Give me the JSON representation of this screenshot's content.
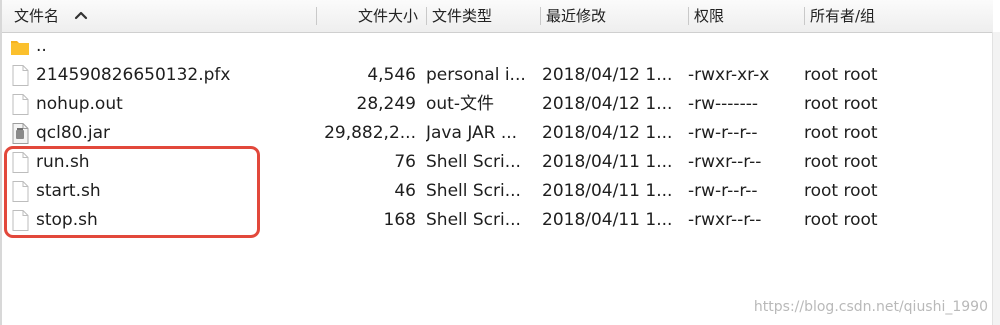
{
  "header": {
    "columns": [
      "文件名",
      "文件大小",
      "文件类型",
      "最近修改",
      "权限",
      "所有者/组"
    ],
    "sort_icon": "chevron-up-icon"
  },
  "files": [
    {
      "name": "..",
      "size": "",
      "type": "",
      "modified": "",
      "permissions": "",
      "owner": "",
      "icon": "folder-icon"
    },
    {
      "name": "214590826650132.pfx",
      "size": "4,546",
      "type": "personal i...",
      "modified": "2018/04/12 1...",
      "permissions": "-rwxr-xr-x",
      "owner": "root root",
      "icon": "file-icon"
    },
    {
      "name": "nohup.out",
      "size": "28,249",
      "type": "out-文件",
      "modified": "2018/04/12 1...",
      "permissions": "-rw-------",
      "owner": "root root",
      "icon": "file-icon"
    },
    {
      "name": "qcl80.jar",
      "size": "29,882,2...",
      "type": "Java JAR ...",
      "modified": "2018/04/12 1...",
      "permissions": "-rw-r--r--",
      "owner": "root root",
      "icon": "jar-file-icon"
    },
    {
      "name": "run.sh",
      "size": "76",
      "type": "Shell Scri...",
      "modified": "2018/04/11 1...",
      "permissions": "-rwxr--r--",
      "owner": "root root",
      "icon": "file-icon"
    },
    {
      "name": "start.sh",
      "size": "46",
      "type": "Shell Scri...",
      "modified": "2018/04/11 1...",
      "permissions": "-rw-r--r--",
      "owner": "root root",
      "icon": "file-icon"
    },
    {
      "name": "stop.sh",
      "size": "168",
      "type": "Shell Scri...",
      "modified": "2018/04/11 1...",
      "permissions": "-rwxr--r--",
      "owner": "root root",
      "icon": "file-icon"
    }
  ],
  "highlight_color": "#e2483b",
  "watermark": "https://blog.csdn.net/qiushi_1990"
}
